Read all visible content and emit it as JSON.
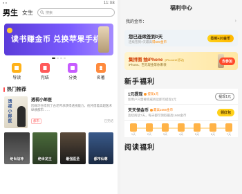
{
  "left": {
    "status_time": "11:08",
    "tabs": {
      "male": "男生",
      "female": "女生"
    },
    "search_placeholder": "搜索",
    "banner_text": "读书赚金币  兑换苹果手机",
    "quick": [
      {
        "label": "导读",
        "color": "#ffb21a"
      },
      {
        "label": "完结",
        "color": "#ff5a5a"
      },
      {
        "label": "分类",
        "color": "#c75cff"
      },
      {
        "label": "名著",
        "color": "#ff8a3d"
      }
    ],
    "section_title": "热门推荐",
    "featured": {
      "cover_title": "透视小郎医",
      "title": "透视小郎医",
      "desc": "因缘巧合得到了古老传承获得透视能力，他凭借着高超医术纵横都市……",
      "tag": "都市",
      "meta": "已完结"
    },
    "covers": [
      {
        "title": "绝世战神",
        "bg": "linear-gradient(180deg,#3a3a3a,#6b6b6b)"
      },
      {
        "title": "绝世龙王",
        "bg": "linear-gradient(180deg,#4a6a3a,#2a3a24)"
      },
      {
        "title": "最强医圣",
        "bg": "linear-gradient(180deg,#5a4a3a,#1a1a1a)"
      },
      {
        "title": "都市仙尊",
        "bg": "linear-gradient(180deg,#3a5a8a,#1a2a44)"
      }
    ]
  },
  "right": {
    "title": "福利中心",
    "coins_label": "我的金币：",
    "coins_arrow": "›",
    "sign": {
      "title": "您已连续签到0天",
      "sub_prefix": "连续签到7天最高",
      "sub_highlight": "得500金币",
      "button": "签到+20金币"
    },
    "iphone": {
      "title": "集拼图 抽iPhone",
      "title_note": "[iPhone12活动]",
      "sub": "iPhone、百元现金等你来领",
      "button": "去参加"
    },
    "new_user_title": "新手福利",
    "tasks": [
      {
        "name": "1元提现",
        "reward": "提现1元",
        "desc": "新用户只需要完成阅读即可提现1元",
        "button": "提现1元",
        "style": "outline"
      },
      {
        "name": "天天领金币",
        "reward": "最高1666金币",
        "desc": "连续阅读7天，每天都可领取最高1666金币",
        "button": "领红包",
        "style": "yellow"
      }
    ],
    "days": [
      "1天",
      "2天",
      "3天",
      "4天",
      "5天",
      "6天",
      "7天"
    ],
    "read_title": "阅读福利"
  }
}
